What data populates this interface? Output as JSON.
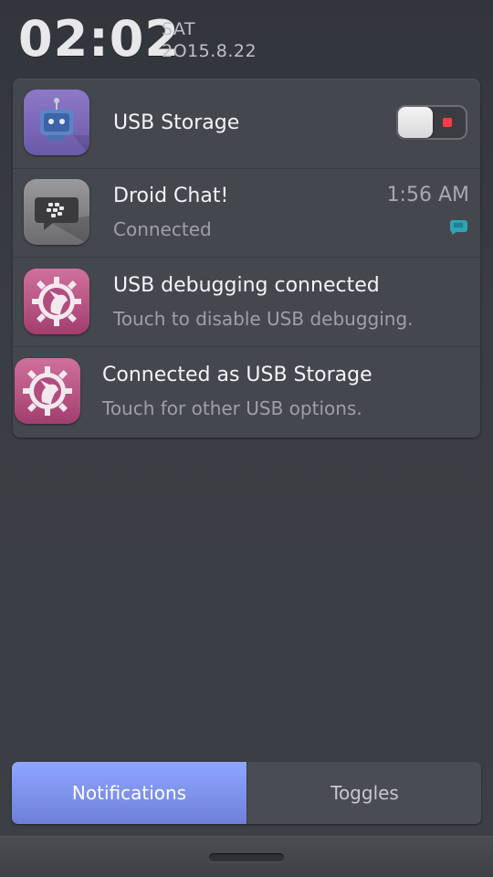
{
  "status": {
    "time": "02:02",
    "day": "SAT",
    "date": "2O15.8.22"
  },
  "notifications": [
    {
      "icon": "robot-icon",
      "title": "USB Storage",
      "switch": {
        "on": false,
        "indicator_color": "#ff3b4a"
      }
    },
    {
      "icon": "blackberry-chat-icon",
      "title": "Droid Chat!",
      "subtitle": "Connected",
      "time": "1:56 AM",
      "small_icon": "chat-bubble-icon"
    },
    {
      "icon": "gear-unicorn-icon",
      "title": "USB debugging connected",
      "subtitle": "Touch to disable USB debugging."
    },
    {
      "icon": "gear-unicorn-icon",
      "title": "Connected as USB Storage",
      "subtitle": "Touch for other USB options."
    }
  ],
  "tabs": [
    {
      "label": "Notifications",
      "active": true
    },
    {
      "label": "Toggles",
      "active": false
    }
  ],
  "colors": {
    "accent": "#7f93f0",
    "background": "#393b42",
    "card": "#45474e"
  }
}
